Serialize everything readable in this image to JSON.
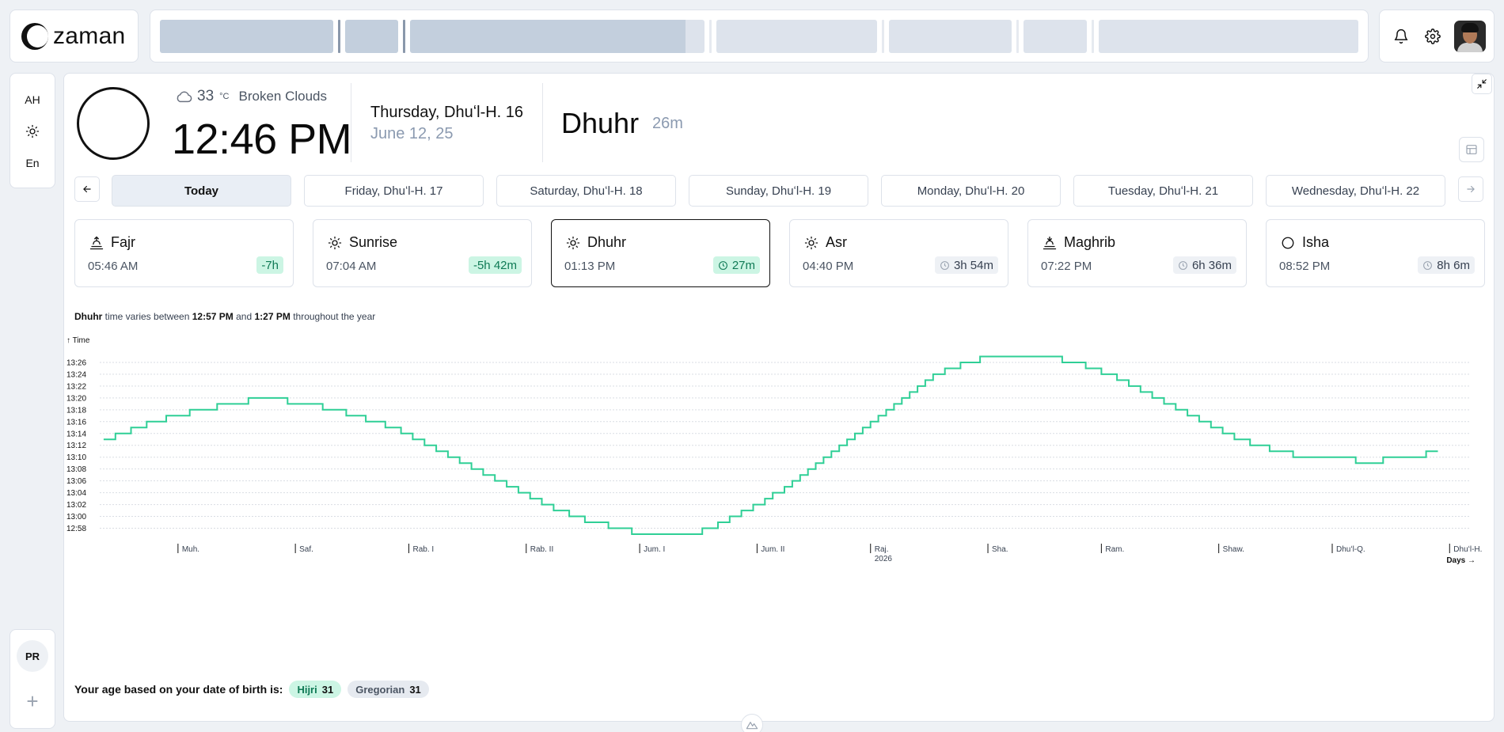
{
  "brand": {
    "name": "zaman"
  },
  "sidebar": {
    "items": [
      "AH",
      "En"
    ],
    "profile_initials": "PR"
  },
  "header": {
    "weather_temp": "33",
    "weather_unit": "°C",
    "weather_desc": "Broken Clouds",
    "time": "12:46 PM",
    "hijri_date": "Thursday, Dhuʻl-H. 16",
    "gregorian_date": "June 12, 25",
    "current_prayer": "Dhuhr",
    "current_prayer_eta": "26m"
  },
  "days": [
    "Today",
    "Friday, Dhuʻl-H. 17",
    "Saturday, Dhuʻl-H. 18",
    "Sunday, Dhuʻl-H. 19",
    "Monday, Dhuʻl-H. 20",
    "Tuesday, Dhuʻl-H. 21",
    "Wednesday, Dhuʻl-H. 22"
  ],
  "prayers": [
    {
      "name": "Fajr",
      "time": "05:46 AM",
      "badge": "-7h",
      "badge_style": "green",
      "icon": "sunrise-arrow-icon"
    },
    {
      "name": "Sunrise",
      "time": "07:04 AM",
      "badge": "-5h 42m",
      "badge_style": "green",
      "icon": "sun-icon"
    },
    {
      "name": "Dhuhr",
      "time": "01:13 PM",
      "badge": "27m",
      "badge_style": "green",
      "icon": "sun-icon"
    },
    {
      "name": "Asr",
      "time": "04:40 PM",
      "badge": "3h 54m",
      "badge_style": "gray",
      "icon": "sun-icon"
    },
    {
      "name": "Maghrib",
      "time": "07:22 PM",
      "badge": "6h 36m",
      "badge_style": "gray",
      "icon": "sunset-arrow-icon"
    },
    {
      "name": "Isha",
      "time": "08:52 PM",
      "badge": "8h 6m",
      "badge_style": "gray",
      "icon": "moon-icon"
    }
  ],
  "variance": {
    "prayer": "Dhuhr",
    "text1": "time varies between",
    "min": "12:57 PM",
    "text2": "and",
    "max": "1:27 PM",
    "text3": "throughout the year"
  },
  "chart_data": {
    "type": "line",
    "step": true,
    "ylabel": "↑ Time",
    "xlabel": "Days →",
    "y_ticks": [
      "12:58",
      "13:00",
      "13:02",
      "13:04",
      "13:06",
      "13:08",
      "13:10",
      "13:12",
      "13:14",
      "13:16",
      "13:18",
      "13:20",
      "13:22",
      "13:24",
      "13:26"
    ],
    "ylim_minutes": [
      777,
      808
    ],
    "x_month_ticks": [
      {
        "label": "Muh.",
        "day": 0
      },
      {
        "label": "Saf.",
        "day": 30
      },
      {
        "label": "Rab. I",
        "day": 59
      },
      {
        "label": "Rab. II",
        "day": 89
      },
      {
        "label": "Jum. I",
        "day": 118
      },
      {
        "label": "Jum. II",
        "day": 148
      },
      {
        "label": "Raj.",
        "sublabel": "2026",
        "day": 177
      },
      {
        "label": "Sha.",
        "day": 207
      },
      {
        "label": "Ram.",
        "day": 236
      },
      {
        "label": "Shaw.",
        "day": 266
      },
      {
        "label": "Dhuʻl-Q.",
        "day": 295
      },
      {
        "label": "Dhuʻl-H.",
        "day": 325
      }
    ],
    "xlim_days": [
      -20,
      330
    ],
    "series": [
      {
        "color": "#2fcf96",
        "points": [
          [
            -19,
            793
          ],
          [
            -16,
            794
          ],
          [
            -12,
            795
          ],
          [
            -8,
            796
          ],
          [
            -3,
            797
          ],
          [
            3,
            798
          ],
          [
            10,
            799
          ],
          [
            18,
            800
          ],
          [
            28,
            799
          ],
          [
            37,
            798
          ],
          [
            43,
            797
          ],
          [
            48,
            796
          ],
          [
            53,
            795
          ],
          [
            57,
            794
          ],
          [
            60,
            793
          ],
          [
            63,
            792
          ],
          [
            66,
            791
          ],
          [
            69,
            790
          ],
          [
            72,
            789
          ],
          [
            75,
            788
          ],
          [
            78,
            787
          ],
          [
            81,
            786
          ],
          [
            84,
            785
          ],
          [
            87,
            784
          ],
          [
            90,
            783
          ],
          [
            93,
            782
          ],
          [
            96,
            781
          ],
          [
            100,
            780
          ],
          [
            104,
            779
          ],
          [
            110,
            778
          ],
          [
            116,
            777
          ],
          [
            134,
            778
          ],
          [
            138,
            779
          ],
          [
            141,
            780
          ],
          [
            144,
            781
          ],
          [
            147,
            782
          ],
          [
            150,
            783
          ],
          [
            152,
            784
          ],
          [
            155,
            785
          ],
          [
            157,
            786
          ],
          [
            159,
            787
          ],
          [
            161,
            788
          ],
          [
            163,
            789
          ],
          [
            165,
            790
          ],
          [
            167,
            791
          ],
          [
            169,
            792
          ],
          [
            171,
            793
          ],
          [
            173,
            794
          ],
          [
            175,
            795
          ],
          [
            177,
            796
          ],
          [
            179,
            797
          ],
          [
            181,
            798
          ],
          [
            183,
            799
          ],
          [
            185,
            800
          ],
          [
            187,
            801
          ],
          [
            189,
            802
          ],
          [
            191,
            803
          ],
          [
            193,
            804
          ],
          [
            196,
            805
          ],
          [
            200,
            806
          ],
          [
            205,
            807
          ],
          [
            226,
            806
          ],
          [
            232,
            805
          ],
          [
            236,
            804
          ],
          [
            240,
            803
          ],
          [
            243,
            802
          ],
          [
            246,
            801
          ],
          [
            249,
            800
          ],
          [
            252,
            799
          ],
          [
            255,
            798
          ],
          [
            258,
            797
          ],
          [
            261,
            796
          ],
          [
            264,
            795
          ],
          [
            267,
            794
          ],
          [
            270,
            793
          ],
          [
            274,
            792
          ],
          [
            279,
            791
          ],
          [
            285,
            790
          ],
          [
            301,
            789
          ],
          [
            308,
            790
          ],
          [
            319,
            791
          ],
          [
            322,
            791
          ]
        ]
      }
    ]
  },
  "age": {
    "label": "Your age based on your date of birth is:",
    "hijri_label": "Hijri",
    "hijri_value": "31",
    "gregorian_label": "Gregorian",
    "gregorian_value": "31"
  }
}
